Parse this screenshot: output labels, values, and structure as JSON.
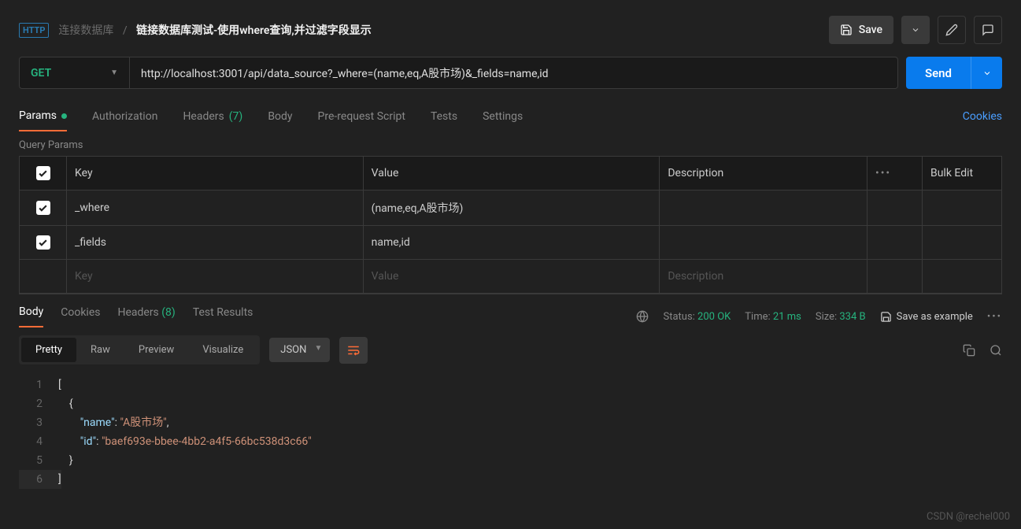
{
  "header": {
    "http_badge": "HTTP",
    "breadcrumb_parent": "连接数据库",
    "breadcrumb_title": "链接数据库测试-使用where查询,并过滤字段显示",
    "save": "Save"
  },
  "request": {
    "method": "GET",
    "url": "http://localhost:3001/api/data_source?_where=(name,eq,A股市场)&_fields=name,id",
    "send": "Send"
  },
  "tabs": [
    {
      "label": "Params",
      "active": true,
      "dot": true
    },
    {
      "label": "Authorization"
    },
    {
      "label": "Headers",
      "count": "(7)"
    },
    {
      "label": "Body"
    },
    {
      "label": "Pre-request Script"
    },
    {
      "label": "Tests"
    },
    {
      "label": "Settings"
    }
  ],
  "cookies_link": "Cookies",
  "section_label": "Query Params",
  "columns": {
    "key": "Key",
    "value": "Value",
    "desc": "Description",
    "bulk": "Bulk Edit"
  },
  "rows": [
    {
      "checked": true,
      "key": "_where",
      "value": "(name,eq,A股市场)",
      "desc": ""
    },
    {
      "checked": true,
      "key": "_fields",
      "value": "name,id",
      "desc": ""
    }
  ],
  "placeholder_row": {
    "key": "Key",
    "value": "Value",
    "desc": "Description"
  },
  "response_tabs": [
    {
      "label": "Body",
      "active": true
    },
    {
      "label": "Cookies"
    },
    {
      "label": "Headers",
      "count": "(8)"
    },
    {
      "label": "Test Results"
    }
  ],
  "status": {
    "label": "Status:",
    "code": "200 OK",
    "time_label": "Time:",
    "time": "21 ms",
    "size_label": "Size:",
    "size": "334 B"
  },
  "save_example": "Save as example",
  "view_tabs": [
    "Pretty",
    "Raw",
    "Preview",
    "Visualize"
  ],
  "format": "JSON",
  "code_lines": [
    {
      "n": 1,
      "html": "<span class='p'>[</span>"
    },
    {
      "n": 2,
      "html": "    <span class='p'>{</span>"
    },
    {
      "n": 3,
      "html": "        <span class='k'>\"name\"</span><span class='p'>: </span><span class='s'>\"A股市场\"</span><span class='p'>,</span>"
    },
    {
      "n": 4,
      "html": "        <span class='k'>\"id\"</span><span class='p'>: </span><span class='s'>\"baef693e-bbee-4bb2-a4f5-66bc538d3c66\"</span>"
    },
    {
      "n": 5,
      "html": "    <span class='p'>}</span>"
    },
    {
      "n": 6,
      "html": "<span class='p'>]</span>",
      "hl": true
    }
  ],
  "watermark": "CSDN @rechel000"
}
